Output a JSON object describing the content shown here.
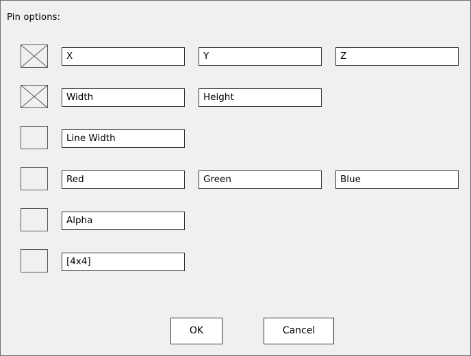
{
  "dialog": {
    "title": "Pin options:",
    "rows": [
      {
        "checked": true,
        "fields": [
          "X",
          "Y",
          "Z"
        ]
      },
      {
        "checked": true,
        "fields": [
          "Width",
          "Height"
        ]
      },
      {
        "checked": false,
        "fields": [
          "Line Width"
        ]
      },
      {
        "checked": false,
        "fields": [
          "Red",
          "Green",
          "Blue"
        ]
      },
      {
        "checked": false,
        "fields": [
          "Alpha"
        ]
      },
      {
        "checked": false,
        "fields": [
          "[4x4]"
        ]
      }
    ],
    "ok_label": "OK",
    "cancel_label": "Cancel"
  }
}
